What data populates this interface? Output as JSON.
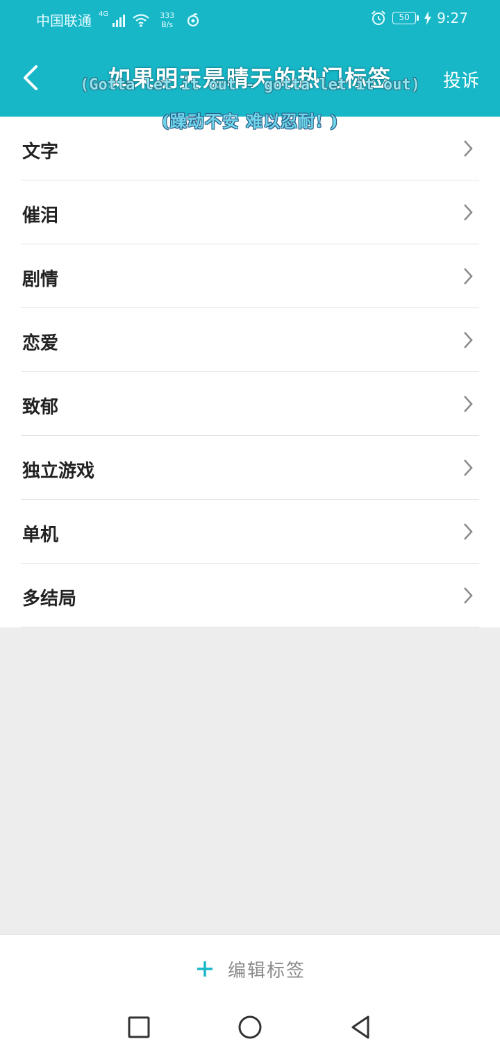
{
  "status_bar": {
    "carrier": "中国联通",
    "network": "4G",
    "speed_value": "333",
    "speed_unit": "B/s",
    "battery": "50",
    "time": "9:27"
  },
  "header": {
    "title": "如果明天是晴天的热门标签",
    "complain_label": "投诉"
  },
  "overlay_lyrics": {
    "line1": "(Gotta let it out - gotta let it out)",
    "line2": "(躁动不安 难以忍耐! )"
  },
  "tags": [
    {
      "label": "文字"
    },
    {
      "label": "催泪"
    },
    {
      "label": "剧情"
    },
    {
      "label": "恋爱"
    },
    {
      "label": "致郁"
    },
    {
      "label": "独立游戏"
    },
    {
      "label": "单机"
    },
    {
      "label": "多结局"
    }
  ],
  "footer": {
    "edit_label": "编辑标签"
  },
  "colors": {
    "accent": "#17b7c8",
    "background": "#ededed"
  }
}
